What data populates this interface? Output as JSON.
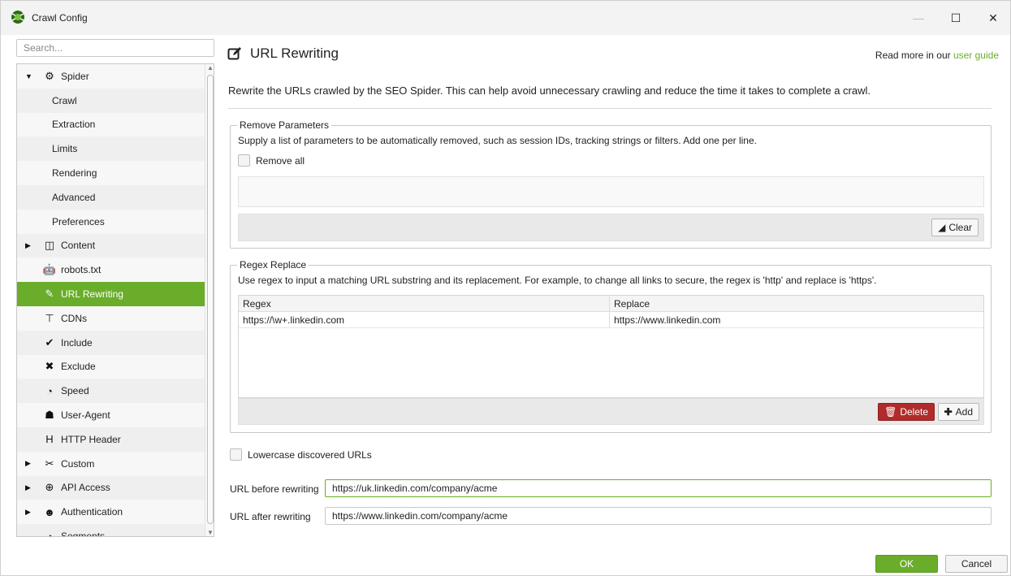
{
  "window": {
    "title": "Crawl Config",
    "minimize": "—",
    "maximize": "☐",
    "close": "✕"
  },
  "sidebar": {
    "search_placeholder": "Search...",
    "items": [
      {
        "label": "Spider",
        "icon": "gear-icon",
        "glyph": "⚙",
        "arrow": "▼",
        "level": 1
      },
      {
        "label": "Crawl",
        "level": 2
      },
      {
        "label": "Extraction",
        "level": 2
      },
      {
        "label": "Limits",
        "level": 2
      },
      {
        "label": "Rendering",
        "level": 2
      },
      {
        "label": "Advanced",
        "level": 2
      },
      {
        "label": "Preferences",
        "level": 2
      },
      {
        "label": "Content",
        "icon": "columns-icon",
        "glyph": "◫",
        "arrow": "▶",
        "level": 1
      },
      {
        "label": "robots.txt",
        "icon": "robot-icon",
        "glyph": "🤖",
        "level": 1
      },
      {
        "label": "URL Rewriting",
        "icon": "edit-icon",
        "glyph": "✎",
        "level": 1,
        "active": true
      },
      {
        "label": "CDNs",
        "icon": "network-icon",
        "glyph": "⊤",
        "level": 1
      },
      {
        "label": "Include",
        "icon": "check-circle-icon",
        "glyph": "✔",
        "level": 1
      },
      {
        "label": "Exclude",
        "icon": "times-circle-icon",
        "glyph": "✖",
        "level": 1
      },
      {
        "label": "Speed",
        "icon": "speedometer-icon",
        "glyph": "◔",
        "level": 1
      },
      {
        "label": "User-Agent",
        "icon": "user-secret-icon",
        "glyph": "☗",
        "level": 1
      },
      {
        "label": "HTTP Header",
        "icon": "header-icon",
        "glyph": "H",
        "level": 1
      },
      {
        "label": "Custom",
        "icon": "tools-icon",
        "glyph": "✂",
        "arrow": "▶",
        "level": 1
      },
      {
        "label": "API Access",
        "icon": "globe-icon",
        "glyph": "⊕",
        "arrow": "▶",
        "level": 1
      },
      {
        "label": "Authentication",
        "icon": "user-lock-icon",
        "glyph": "☻",
        "arrow": "▶",
        "level": 1
      },
      {
        "label": "Segments",
        "icon": "pie-icon",
        "glyph": "◕",
        "level": 1
      }
    ]
  },
  "main": {
    "title": "URL Rewriting",
    "read_more_prefix": "Read more in our ",
    "read_more_link": "user guide",
    "description": "Rewrite the URLs crawled by the SEO Spider. This can help avoid unnecessary crawling and reduce the time it takes to complete a crawl.",
    "remove_parameters": {
      "legend": "Remove Parameters",
      "description": "Supply a list of parameters to be automatically removed, such as session IDs, tracking strings or filters. Add one per line.",
      "remove_all_label": "Remove all",
      "clear_label": "Clear"
    },
    "regex_replace": {
      "legend": "Regex Replace",
      "description": "Use regex to input a matching URL substring and its replacement. For example, to change all links to secure, the regex is 'http' and replace is 'https'.",
      "columns": [
        "Regex",
        "Replace"
      ],
      "rows": [
        [
          "https://\\w+.linkedin.com",
          "https://www.linkedin.com"
        ]
      ],
      "delete_label": "Delete",
      "add_label": "Add"
    },
    "lowercase_label": "Lowercase discovered URLs",
    "url_before_label": "URL before rewriting",
    "url_before_value": "https://uk.linkedin.com/company/acme",
    "url_after_label": "URL after rewriting",
    "url_after_value": "https://www.linkedin.com/company/acme"
  },
  "footer": {
    "ok_label": "OK",
    "cancel_label": "Cancel"
  },
  "colors": {
    "accent": "#6aad2a",
    "danger": "#b02b2b"
  }
}
